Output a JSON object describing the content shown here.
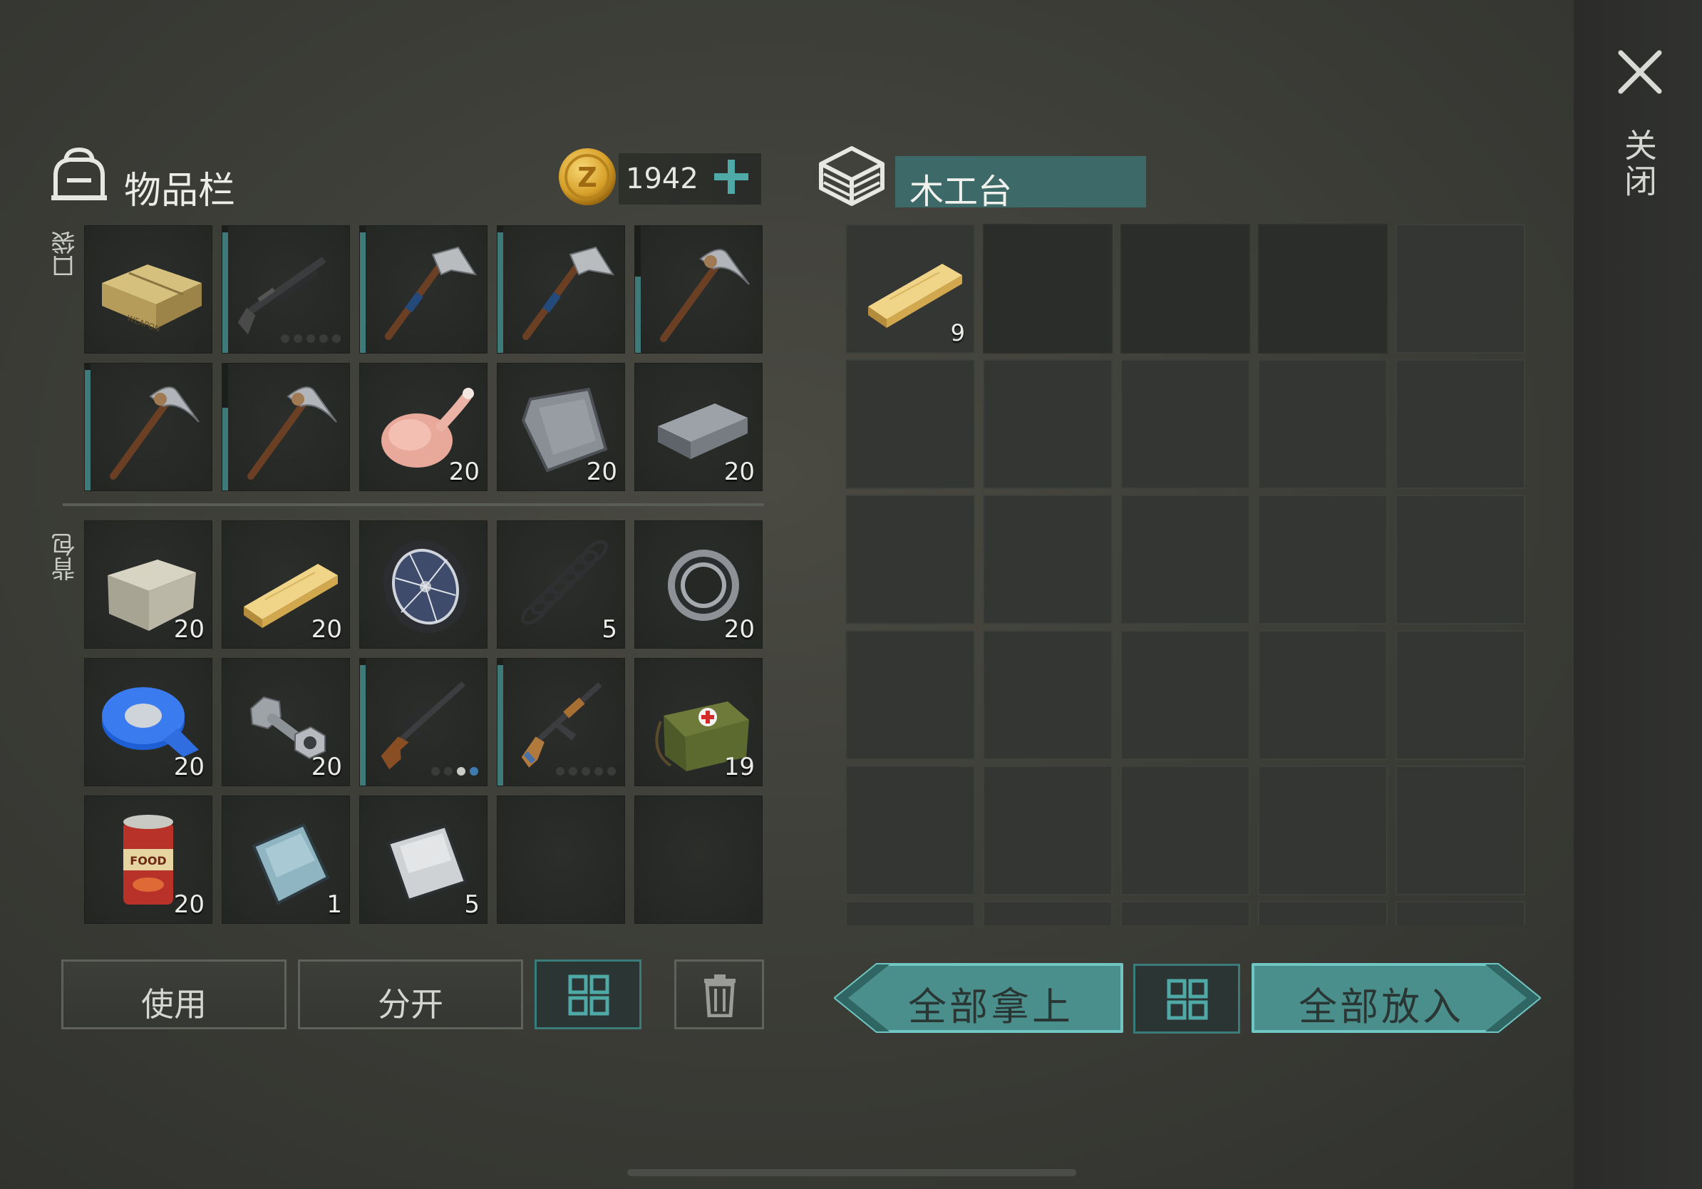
{
  "inventory": {
    "title": "物品栏",
    "coins": "1942",
    "pocket_label": "口袋",
    "backpack_label": "背包",
    "pocket": [
      {
        "icon": "weapon-crate-icon",
        "qty": "",
        "durability": null,
        "dots": null
      },
      {
        "icon": "shotgun-icon",
        "qty": "",
        "durability": 0.95,
        "dots": [
          0,
          0,
          0,
          0,
          0
        ]
      },
      {
        "icon": "hatchet-icon",
        "qty": "",
        "durability": 0.95,
        "dots": null
      },
      {
        "icon": "hatchet-icon",
        "qty": "",
        "durability": 0.95,
        "dots": null
      },
      {
        "icon": "pickaxe-icon",
        "qty": "",
        "durability": 0.6,
        "dots": null
      },
      {
        "icon": "pickaxe-icon",
        "qty": "",
        "durability": 0.95,
        "dots": null
      },
      {
        "icon": "pickaxe-icon",
        "qty": "",
        "durability": 0.65,
        "dots": null
      },
      {
        "icon": "raw-chicken-icon",
        "qty": "20",
        "durability": null,
        "dots": null
      },
      {
        "icon": "iron-plate-icon",
        "qty": "20",
        "durability": null,
        "dots": null
      },
      {
        "icon": "iron-ingot-icon",
        "qty": "20",
        "durability": null,
        "dots": null
      }
    ],
    "backpack": [
      {
        "icon": "stone-block-icon",
        "qty": "20",
        "durability": null,
        "dots": null
      },
      {
        "icon": "wooden-plank-icon",
        "qty": "20",
        "durability": null,
        "dots": null
      },
      {
        "icon": "wheel-icon",
        "qty": "",
        "durability": null,
        "dots": null
      },
      {
        "icon": "spring-icon",
        "qty": "5",
        "durability": null,
        "dots": null
      },
      {
        "icon": "bearing-icon",
        "qty": "20",
        "durability": null,
        "dots": null
      },
      {
        "icon": "duct-tape-icon",
        "qty": "20",
        "durability": null,
        "dots": null
      },
      {
        "icon": "bolt-nut-icon",
        "qty": "20",
        "durability": null,
        "dots": null
      },
      {
        "icon": "sniper-rifle-icon",
        "qty": "",
        "durability": 0.95,
        "dots": [
          0,
          0,
          1,
          2
        ]
      },
      {
        "icon": "assault-rifle-icon",
        "qty": "",
        "durability": 0.95,
        "dots": [
          0,
          0,
          0,
          0,
          0
        ]
      },
      {
        "icon": "medkit-bag-icon",
        "qty": "19",
        "durability": null,
        "dots": null
      },
      {
        "icon": "canned-food-icon",
        "qty": "20",
        "durability": null,
        "dots": null
      },
      {
        "icon": "glass-sheet-icon",
        "qty": "1",
        "durability": null,
        "dots": null
      },
      {
        "icon": "aluminum-sheet-icon",
        "qty": "5",
        "durability": null,
        "dots": null
      },
      {
        "icon": "",
        "qty": "",
        "durability": null,
        "dots": null
      },
      {
        "icon": "",
        "qty": "",
        "durability": null,
        "dots": null
      }
    ],
    "buttons": {
      "use": "使用",
      "split": "分开"
    }
  },
  "container": {
    "title": "木工台",
    "slots": [
      {
        "icon": "wooden-plank-icon",
        "qty": "9"
      }
    ],
    "buttons": {
      "take_all": "全部拿上",
      "put_all": "全部放入"
    }
  },
  "close_label": "关闭",
  "colors": {
    "accent": "#4fa9a6",
    "accent_dark": "#3d6a69",
    "durability": "#3f7a7a"
  }
}
